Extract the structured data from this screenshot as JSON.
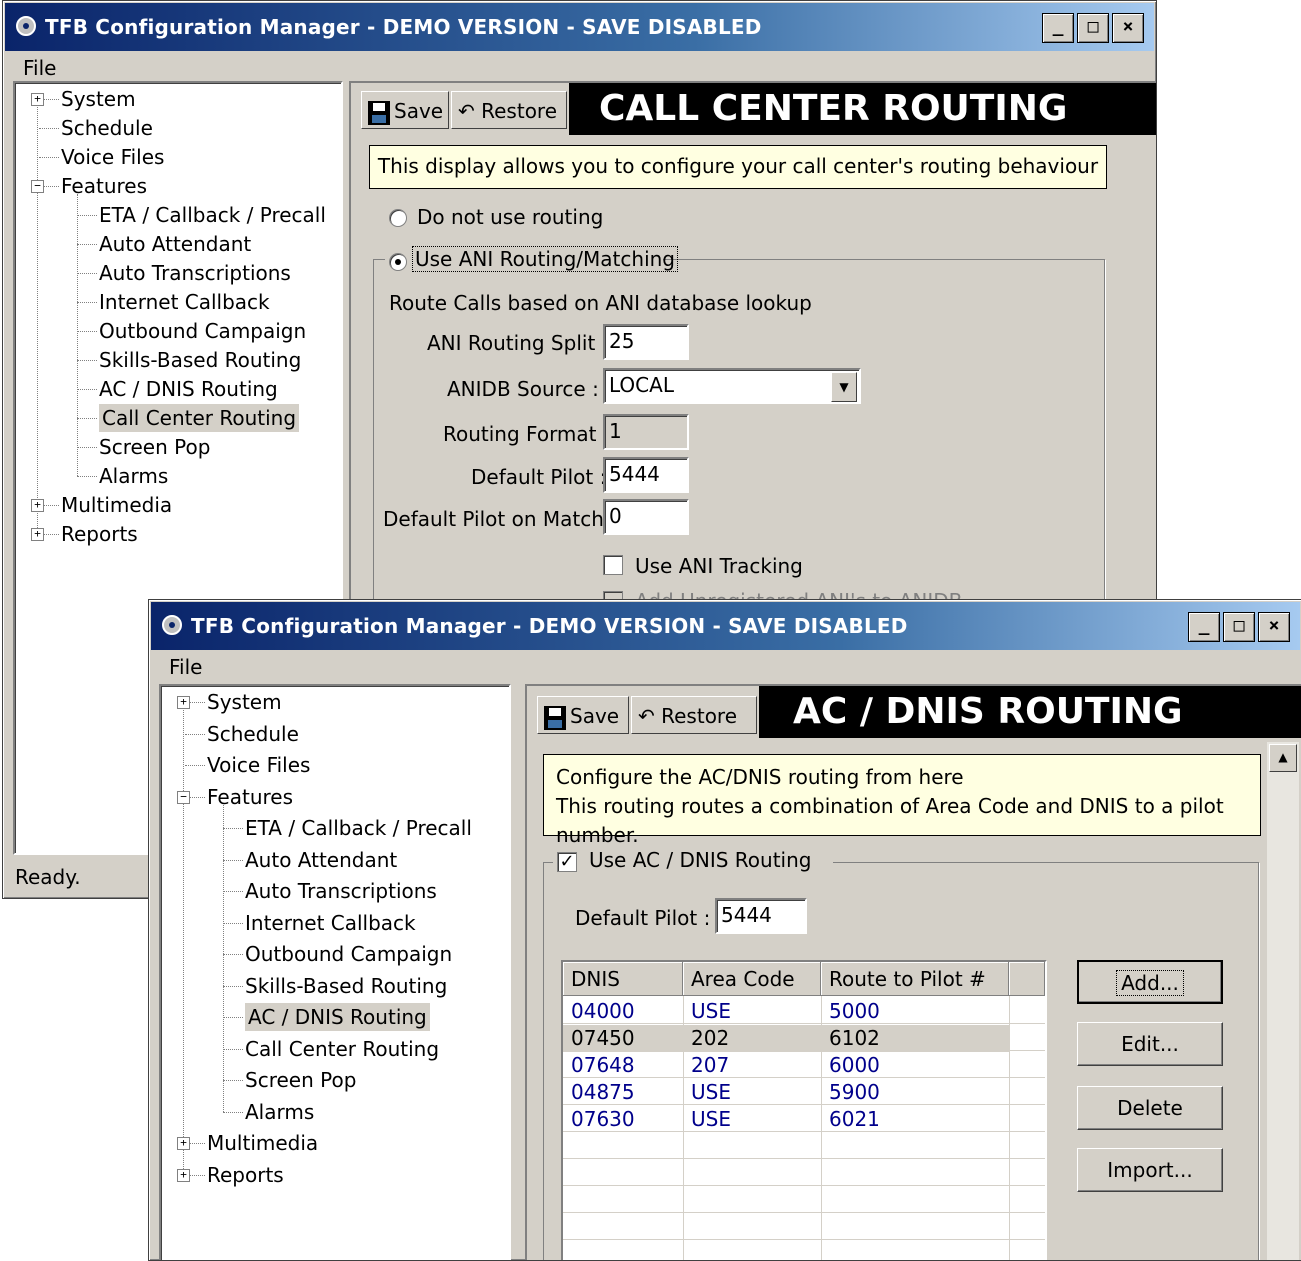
{
  "window1": {
    "title": "TFB Configuration Manager - DEMO VERSION - SAVE DISABLED",
    "controls": {
      "minimize": "_",
      "maximize": "□",
      "close": "×"
    },
    "menu": {
      "file": "File"
    },
    "tree": [
      {
        "label": "System",
        "expander": "+"
      },
      {
        "label": "Schedule"
      },
      {
        "label": "Voice Files"
      },
      {
        "label": "Features",
        "expander": "−"
      },
      {
        "label": "ETA / Callback / Precall"
      },
      {
        "label": "Auto Attendant"
      },
      {
        "label": "Auto Transcriptions"
      },
      {
        "label": "Internet Callback"
      },
      {
        "label": "Outbound Campaign"
      },
      {
        "label": "Skills-Based Routing"
      },
      {
        "label": "AC / DNIS Routing"
      },
      {
        "label": "Call Center Routing",
        "selected": true
      },
      {
        "label": "Screen Pop"
      },
      {
        "label": "Alarms"
      },
      {
        "label": "Multimedia",
        "expander": "+"
      },
      {
        "label": "Reports",
        "expander": "+"
      }
    ],
    "toolbar": {
      "save": "Save",
      "restore": "Restore"
    },
    "header": "CALL CENTER ROUTING",
    "info": "This display allows you to configure your call center's routing behaviour",
    "radio_no_routing": "Do not use routing",
    "radio_ani": "Use ANI Routing/Matching",
    "group_desc": "Route Calls based on ANI database lookup",
    "fields": {
      "ani_split_label": "ANI Routing Split :",
      "ani_split_value": "25",
      "anidb_source_label": "ANIDB Source :",
      "anidb_source_value": "LOCAL",
      "routing_format_label": "Routing Format :",
      "routing_format_value": "1",
      "default_pilot_label": "Default Pilot :",
      "default_pilot_value": "5444",
      "default_pilot_match_label": "Default Pilot on Match :",
      "default_pilot_match_value": "0"
    },
    "use_ani_tracking": "Use ANI Tracking",
    "add_unregistered": "Add Unregistered ANI's to ANIDB",
    "status": "Ready."
  },
  "window2": {
    "title": "TFB Configuration Manager - DEMO VERSION - SAVE DISABLED",
    "controls": {
      "minimize": "_",
      "maximize": "□",
      "close": "×"
    },
    "menu": {
      "file": "File"
    },
    "tree": [
      {
        "label": "System",
        "expander": "+"
      },
      {
        "label": "Schedule"
      },
      {
        "label": "Voice Files"
      },
      {
        "label": "Features",
        "expander": "−"
      },
      {
        "label": "ETA / Callback / Precall"
      },
      {
        "label": "Auto Attendant"
      },
      {
        "label": "Auto Transcriptions"
      },
      {
        "label": "Internet Callback"
      },
      {
        "label": "Outbound Campaign"
      },
      {
        "label": "Skills-Based Routing"
      },
      {
        "label": "AC / DNIS Routing",
        "selected": true
      },
      {
        "label": "Call Center Routing"
      },
      {
        "label": "Screen Pop"
      },
      {
        "label": "Alarms"
      },
      {
        "label": "Multimedia",
        "expander": "+"
      },
      {
        "label": "Reports",
        "expander": "+"
      }
    ],
    "toolbar": {
      "save": "Save",
      "restore": "Restore"
    },
    "header": "AC / DNIS ROUTING",
    "info_line1": "Configure the AC/DNIS routing from here",
    "info_line2": "This routing routes a combination of Area Code and DNIS to a pilot number.",
    "use_routing": "Use AC / DNIS Routing",
    "default_pilot_label": "Default Pilot :",
    "default_pilot_value": "5444",
    "table": {
      "columns": [
        "DNIS",
        "Area Code",
        "Route to Pilot #"
      ],
      "rows": [
        [
          "04000",
          "USE",
          "5000"
        ],
        [
          "07450",
          "202",
          "6102"
        ],
        [
          "07648",
          "207",
          "6000"
        ],
        [
          "04875",
          "USE",
          "5900"
        ],
        [
          "07630",
          "USE",
          "6021"
        ]
      ]
    },
    "buttons": {
      "add": "Add...",
      "edit": "Edit...",
      "delete": "Delete",
      "import": "Import..."
    },
    "colors": {
      "row_text": "#00008b",
      "selected_row": "#d4d0c8"
    }
  }
}
